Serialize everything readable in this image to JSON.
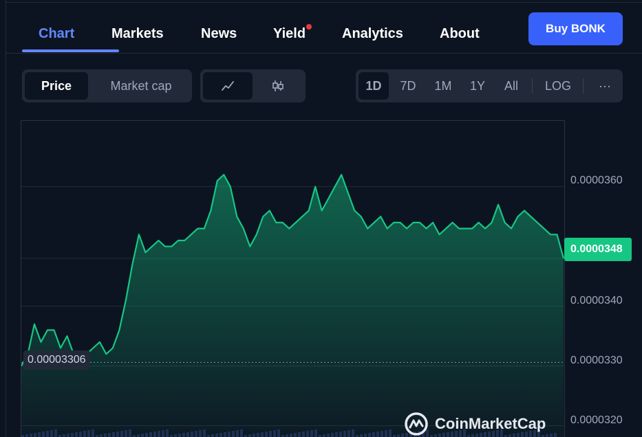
{
  "tabs": [
    {
      "label": "Chart",
      "active": true
    },
    {
      "label": "Markets",
      "active": false
    },
    {
      "label": "News",
      "active": false
    },
    {
      "label": "Yield",
      "active": false,
      "has_dot": true
    },
    {
      "label": "Analytics",
      "active": false
    },
    {
      "label": "About",
      "active": false
    }
  ],
  "buy_button": "Buy BONK",
  "metric_toggle": {
    "price": "Price",
    "market_cap": "Market cap",
    "selected": "Price"
  },
  "chart_type_toggle": {
    "line_icon": "line-chart-icon",
    "candle_icon": "candlestick-icon",
    "selected": "line"
  },
  "time_ranges": [
    "1D",
    "7D",
    "1M",
    "1Y",
    "All"
  ],
  "selected_range": "1D",
  "log_label": "LOG",
  "more_label": "···",
  "colors": {
    "background": "#0d1421",
    "panel": "#222a3a",
    "accent": "#6188ff",
    "buy": "#3861fb",
    "up": "#16c784",
    "notification": "#ea3943"
  },
  "watermark": "CoinMarketCap",
  "chart_data": {
    "type": "area",
    "y_axis_ticks": [
      "0.0000360",
      "0.0000348",
      "0.0000340",
      "0.0000330",
      "0.0000320"
    ],
    "ylim": [
      3.18e-05,
      3.71e-05
    ],
    "open_price_label": "0.00003306",
    "open_price": 3.306e-05,
    "current_price_label": "0.0000348",
    "current_price": 3.48e-05,
    "line_color": "#16c784",
    "x": [
      0,
      1,
      2,
      3,
      4,
      5,
      6,
      7,
      8,
      9,
      10,
      11,
      12,
      13,
      14,
      15,
      16,
      17,
      18,
      19,
      20,
      21,
      22,
      23,
      24,
      25,
      26,
      27,
      28,
      29,
      30,
      31,
      32,
      33,
      34,
      35,
      36,
      37,
      38,
      39,
      40,
      41,
      42,
      43,
      44,
      45,
      46,
      47,
      48,
      49,
      50,
      51,
      52,
      53,
      54,
      55,
      56,
      57,
      58,
      59,
      60,
      61,
      62,
      63,
      64,
      65,
      66,
      67,
      68,
      69,
      70,
      71,
      72,
      73,
      74,
      75,
      76,
      77,
      78,
      79,
      80,
      81,
      82,
      83,
      84,
      85,
      86,
      87,
      88,
      89,
      90,
      91,
      92,
      93,
      94,
      95,
      96,
      97,
      98,
      99,
      100
    ],
    "values": [
      3.3e-05,
      3.32e-05,
      3.37e-05,
      3.34e-05,
      3.36e-05,
      3.36e-05,
      3.33e-05,
      3.35e-05,
      3.32e-05,
      3.31e-05,
      3.32e-05,
      3.33e-05,
      3.34e-05,
      3.32e-05,
      3.33e-05,
      3.36e-05,
      3.41e-05,
      3.47e-05,
      3.52e-05,
      3.49e-05,
      3.5e-05,
      3.51e-05,
      3.5e-05,
      3.5e-05,
      3.51e-05,
      3.51e-05,
      3.52e-05,
      3.53e-05,
      3.53e-05,
      3.56e-05,
      3.61e-05,
      3.62e-05,
      3.6e-05,
      3.55e-05,
      3.53e-05,
      3.5e-05,
      3.52e-05,
      3.55e-05,
      3.56e-05,
      3.54e-05,
      3.54e-05,
      3.53e-05,
      3.54e-05,
      3.55e-05,
      3.56e-05,
      3.6e-05,
      3.56e-05,
      3.58e-05,
      3.6e-05,
      3.62e-05,
      3.59e-05,
      3.56e-05,
      3.55e-05,
      3.53e-05,
      3.54e-05,
      3.55e-05,
      3.53e-05,
      3.54e-05,
      3.54e-05,
      3.53e-05,
      3.54e-05,
      3.54e-05,
      3.53e-05,
      3.54e-05,
      3.52e-05,
      3.53e-05,
      3.54e-05,
      3.53e-05,
      3.53e-05,
      3.53e-05,
      3.54e-05,
      3.53e-05,
      3.54e-05,
      3.57e-05,
      3.54e-05,
      3.53e-05,
      3.55e-05,
      3.56e-05,
      3.55e-05,
      3.54e-05,
      3.53e-05,
      3.52e-05,
      3.52e-05,
      3.48e-05
    ],
    "grid": true
  }
}
